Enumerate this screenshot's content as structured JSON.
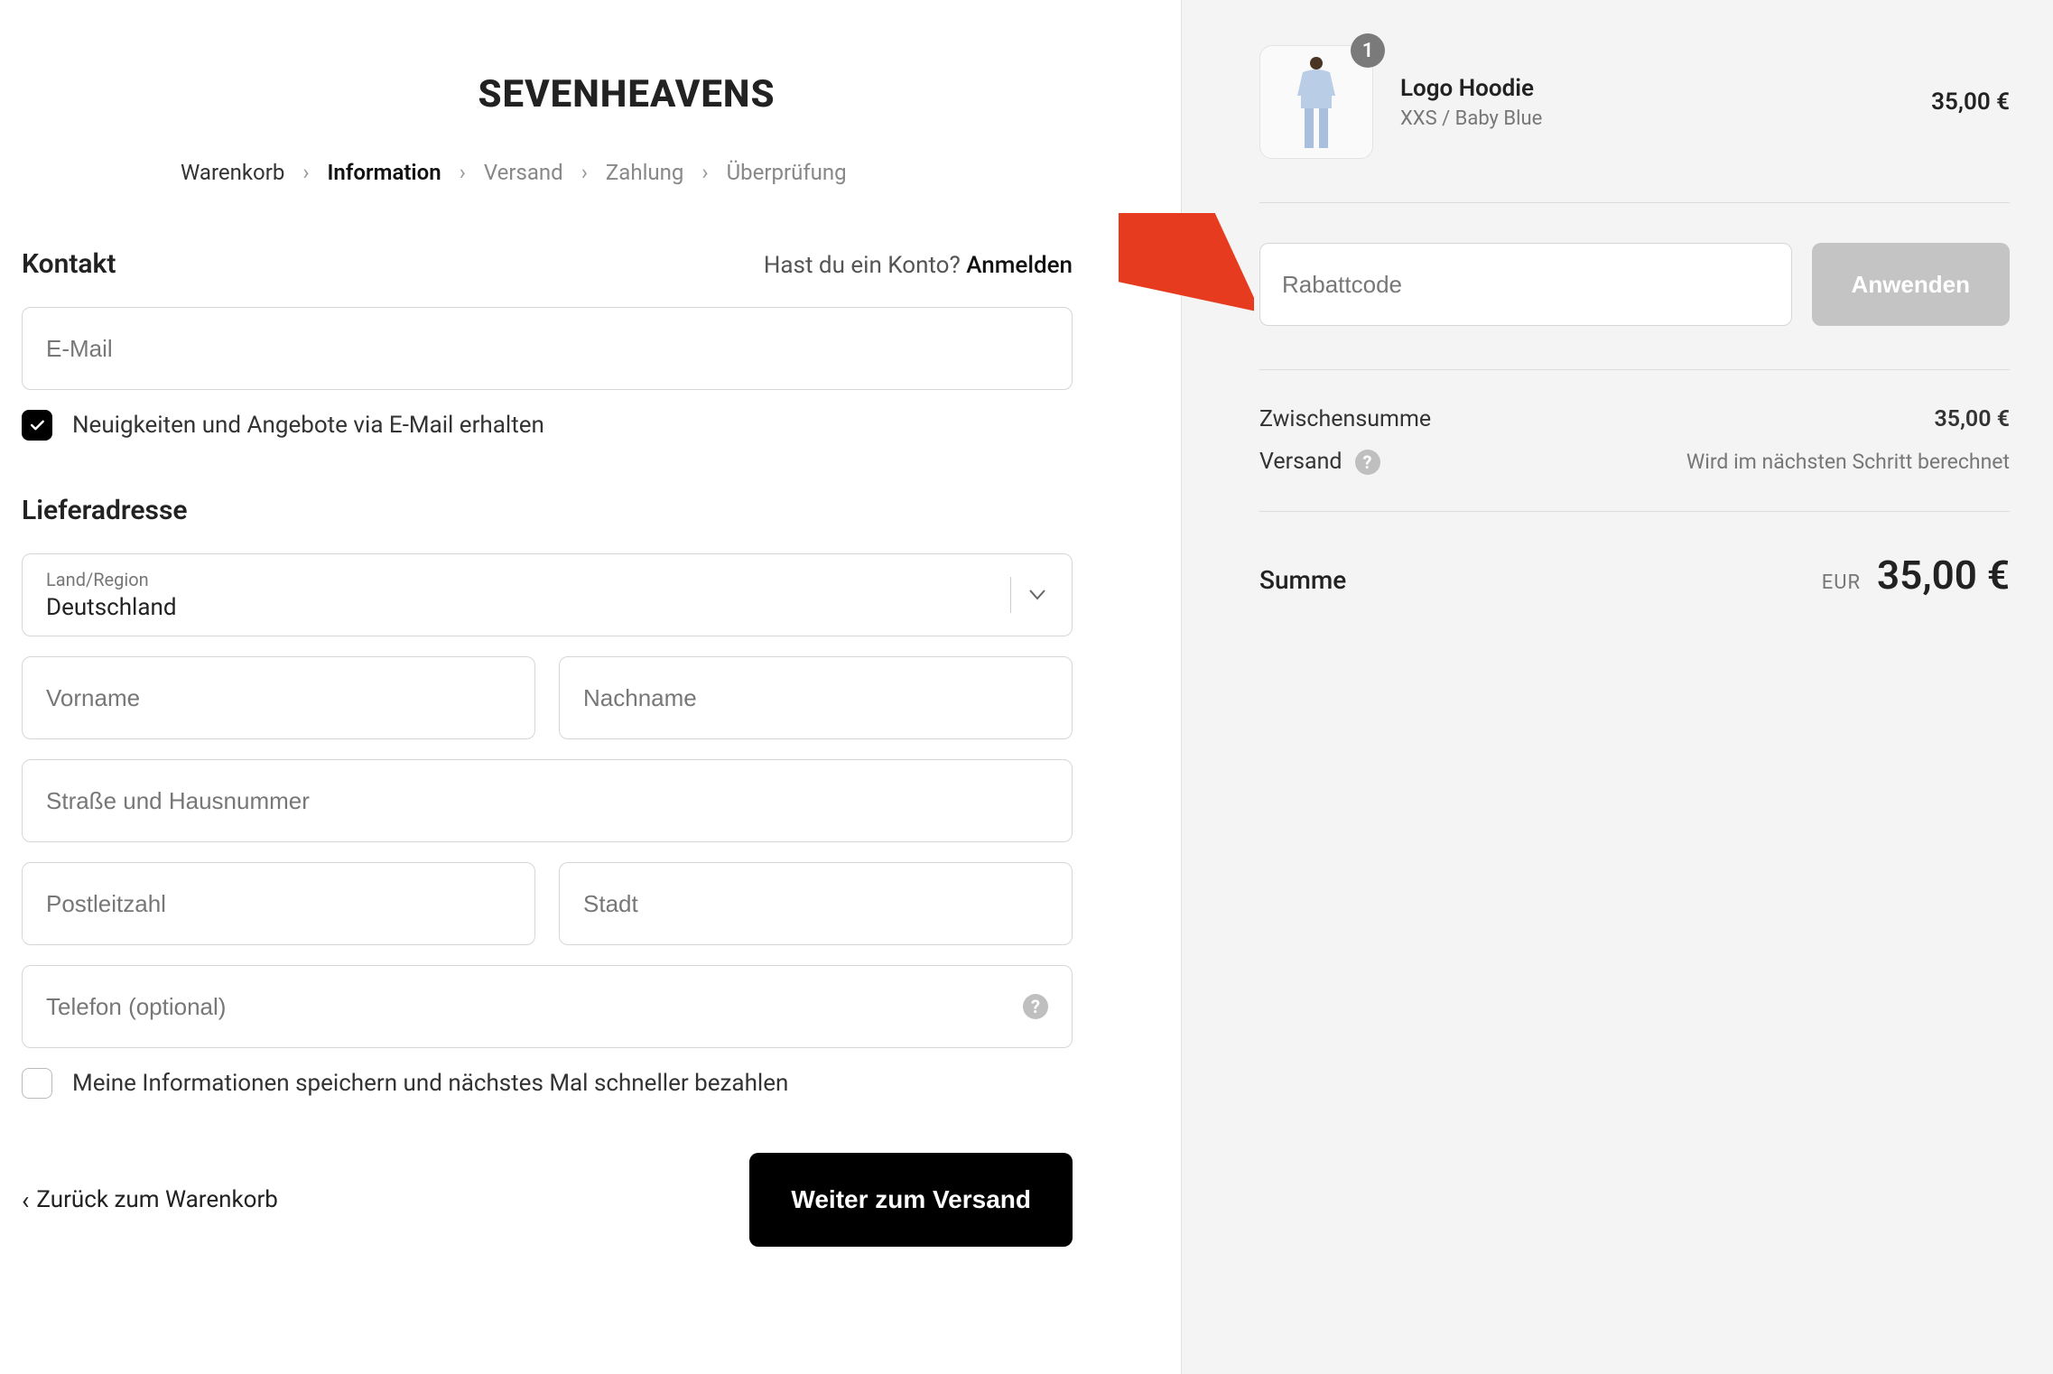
{
  "brand": "SEVENHEAVENS",
  "breadcrumb": {
    "cart": "Warenkorb",
    "information": "Information",
    "shipping": "Versand",
    "payment": "Zahlung",
    "review": "Überprüfung"
  },
  "contact": {
    "title": "Kontakt",
    "login_prompt": "Hast du ein Konto?",
    "login_link": "Anmelden",
    "email_placeholder": "E-Mail",
    "newsletter_label": "Neuigkeiten und Angebote via E-Mail erhalten",
    "newsletter_checked": true
  },
  "shipping_address": {
    "title": "Lieferadresse",
    "country_label": "Land/Region",
    "country_value": "Deutschland",
    "first_name_placeholder": "Vorname",
    "last_name_placeholder": "Nachname",
    "street_placeholder": "Straße und Hausnummer",
    "zip_placeholder": "Postleitzahl",
    "city_placeholder": "Stadt",
    "phone_placeholder": "Telefon (optional)",
    "save_info_label": "Meine Informationen speichern und nächstes Mal schneller bezahlen",
    "save_info_checked": false
  },
  "footer": {
    "back_label": "Zurück zum Warenkorb",
    "continue_label": "Weiter zum Versand"
  },
  "cart": {
    "item": {
      "name": "Logo Hoodie",
      "variant": "XXS / Baby Blue",
      "qty": "1",
      "price": "35,00 €"
    },
    "discount": {
      "placeholder": "Rabattcode",
      "apply_label": "Anwenden"
    },
    "subtotal_label": "Zwischensumme",
    "subtotal_value": "35,00 €",
    "shipping_label": "Versand",
    "shipping_note": "Wird im nächsten Schritt berechnet",
    "total_label": "Summe",
    "total_currency": "EUR",
    "total_value": "35,00 €"
  }
}
